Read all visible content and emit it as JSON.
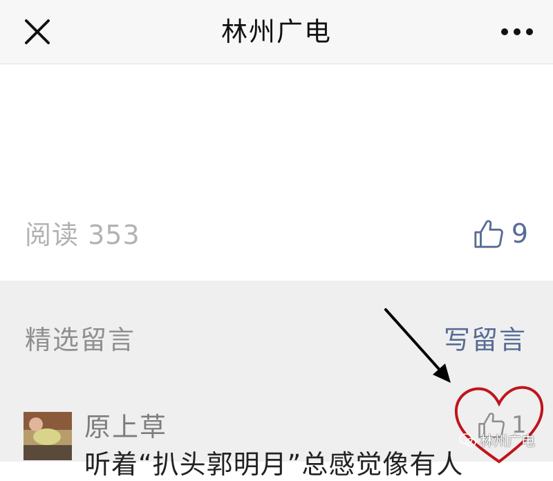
{
  "header": {
    "title": "林州广电",
    "close_icon": "close-icon",
    "more_icon": "more-dots-icon"
  },
  "article": {
    "read_label": "阅读",
    "read_count": "353",
    "like_count": "9",
    "like_icon": "thumbs-up-icon"
  },
  "comments": {
    "section_title": "精选留言",
    "write_label": "写留言",
    "items": [
      {
        "author": "原上草",
        "text": "听着“扒头郭明月”总感觉像有人",
        "like_count": "1",
        "avatar_icon": "user-avatar"
      }
    ]
  },
  "annotations": {
    "arrow_color": "#000000",
    "heart_color": "#c0141c"
  },
  "watermark": {
    "text": "林州广电",
    "icon": "wechat-icon"
  },
  "colors": {
    "link": "#576b95",
    "muted": "#b2b2b2",
    "comment_bg": "#efefef"
  }
}
